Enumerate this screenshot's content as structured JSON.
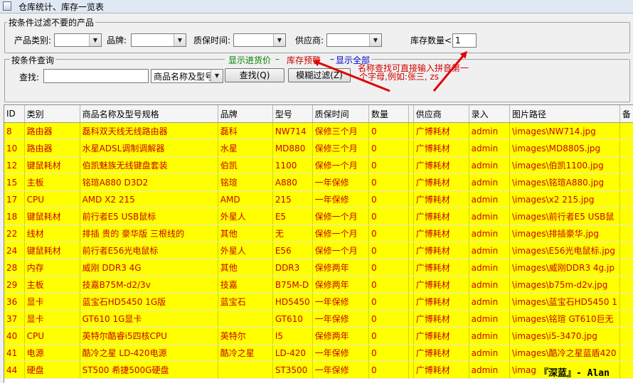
{
  "window": {
    "title": "仓库统计、库存一览表"
  },
  "filter_group": {
    "label": "按条件过滤不要的产品",
    "category_label": "产品类别:",
    "category_value": "",
    "brand_label": "品牌:",
    "brand_value": "",
    "warranty_label": "质保时间:",
    "warranty_value": "",
    "supplier_label": "供应商:",
    "supplier_value": "",
    "stock_label": "库存数量<",
    "stock_value": "1"
  },
  "query_group": {
    "label": "按条件查询",
    "link_show_price": "显示进货价",
    "link_stock_alert": "库存预警",
    "link_show_all": "显示全部",
    "find_label": "查找:",
    "find_value": "",
    "field_select_value": "商品名称及型号",
    "find_button": "查找(Q)",
    "fuzzy_button": "模糊过滤(Z)"
  },
  "annotation": {
    "line1": "名称查找可直接输入拼音第一",
    "line2": "个字母,例如:张三, zs"
  },
  "table": {
    "columns": [
      "ID",
      "类别",
      "商品名称及型号规格",
      "品牌",
      "型号",
      "质保时间",
      "数量",
      "",
      "供应商",
      "录入",
      "图片路径",
      "备"
    ],
    "rows": [
      [
        "8",
        "路由器",
        "磊科双天线无线路由器",
        "磊科",
        "NW714",
        "保修三个月",
        "0",
        "",
        "广博耗材",
        "admin",
        "\\images\\NW714.jpg",
        ""
      ],
      [
        "10",
        "路由器",
        "水星ADSL调制调解器",
        "水星",
        "MD880",
        "保修三个月",
        "0",
        "",
        "广博耗材",
        "admin",
        "\\images\\MD880S.jpg",
        ""
      ],
      [
        "12",
        "键鼠耗材",
        "伯凯魅族无线键盘套装",
        "伯凯",
        "1100",
        "保修一个月",
        "0",
        "",
        "广博耗材",
        "admin",
        "\\images\\伯凯1100.jpg",
        ""
      ],
      [
        "15",
        "主板",
        "铭瑄A880 D3D2",
        "铭瑄",
        "A880",
        "一年保修",
        "0",
        "",
        "广博耗材",
        "admin",
        "\\images\\铭瑄A880.jpg",
        ""
      ],
      [
        "17",
        "CPU",
        "AMD X2 215",
        "AMD",
        "215",
        "一年保修",
        "0",
        "",
        "广博耗材",
        "admin",
        "\\images\\x2 215.jpg",
        ""
      ],
      [
        "18",
        "键鼠耗材",
        "前行者E5 USB鼠标",
        "外星人",
        "E5",
        "保修一个月",
        "0",
        "",
        "广博耗材",
        "admin",
        "\\images\\前行者E5 USB鼠",
        ""
      ],
      [
        "22",
        "线材",
        "排插 贵的 豪华版 三根线的",
        "其他",
        "无",
        "保修一个月",
        "0",
        "",
        "广博耗材",
        "admin",
        "\\images\\排插豪华.jpg",
        ""
      ],
      [
        "24",
        "键鼠耗材",
        "前行者E56光电鼠标",
        "外星人",
        "E56",
        "保修一个月",
        "0",
        "",
        "广博耗材",
        "admin",
        "\\images\\E56光电鼠标.jpg",
        ""
      ],
      [
        "28",
        "内存",
        "威刚 DDR3 4G",
        "其他",
        "DDR3",
        "保修两年",
        "0",
        "",
        "广博耗材",
        "admin",
        "\\images\\威刚DDR3 4g.jp",
        ""
      ],
      [
        "29",
        "主板",
        "技嘉B75M-d2/3v",
        "技嘉",
        "B75M-D",
        "保修两年",
        "0",
        "",
        "广博耗材",
        "admin",
        "\\images\\b75m-d2v.jpg",
        ""
      ],
      [
        "36",
        "显卡",
        "蓝宝石HD5450 1G版",
        "蓝宝石",
        "HD5450",
        "一年保修",
        "0",
        "",
        "广博耗材",
        "admin",
        "\\images\\蓝宝石HD5450 1",
        ""
      ],
      [
        "37",
        "显卡",
        "GT610 1G显卡",
        "",
        "GT610",
        "一年保修",
        "0",
        "",
        "广博耗材",
        "admin",
        "\\images\\铭瑄 GT610巨无",
        ""
      ],
      [
        "40",
        "CPU",
        "英特尔酷睿i5四核CPU",
        "英特尔",
        "I5",
        "保修两年",
        "0",
        "",
        "广博耗材",
        "admin",
        "\\images\\i5-3470.jpg",
        ""
      ],
      [
        "41",
        "电源",
        "酷冷之星 LD-420电源",
        "酷冷之星",
        "LD-420",
        "一年保修",
        "0",
        "",
        "广博耗材",
        "admin",
        "\\images\\酷冷之星蓝盾420",
        ""
      ],
      [
        "44",
        "硬盘",
        "ST500 希捷500G硬盘",
        "",
        "ST3500",
        "一年保修",
        "0",
        "",
        "广博耗材",
        "admin",
        "\\imag",
        ""
      ]
    ]
  },
  "watermark": "『深蓝』- Alan",
  "colors": {
    "row_bg": "#ffff00",
    "row_text": "#cc0000",
    "link_green": "#008000",
    "link_red": "#cc0000",
    "link_blue": "#0000cc",
    "arrow_red": "#e00000"
  }
}
